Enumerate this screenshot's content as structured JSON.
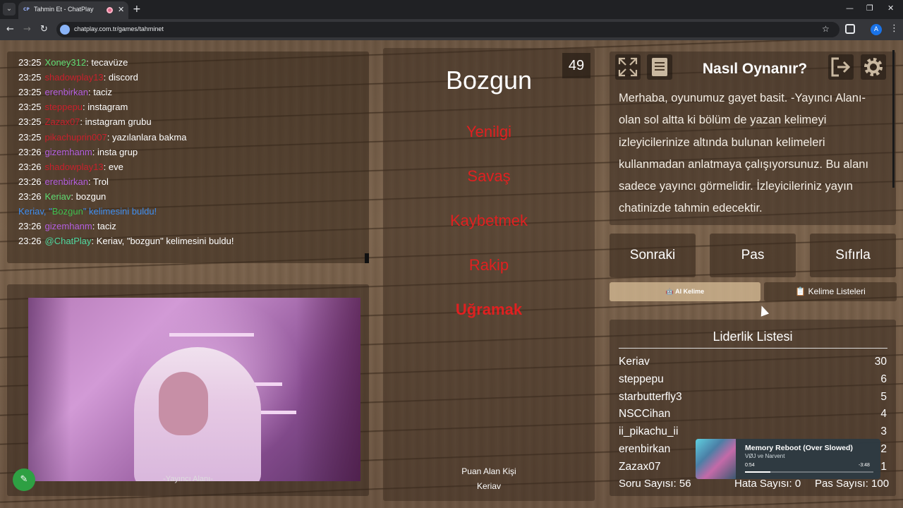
{
  "browser": {
    "tab_title": "Tahmin Et - ChatPlay",
    "tab_favicon": "CP",
    "url": "chatplay.com.tr/games/tahminet",
    "profile_initial": "A"
  },
  "chat": {
    "lines": [
      {
        "time": "23:25",
        "user": "Xoney312",
        "color": "#5fdc73",
        "msg": ": tecavüze"
      },
      {
        "time": "23:25",
        "user": "shadowplay13",
        "color": "#c7202c",
        "msg": ": discord"
      },
      {
        "time": "23:25",
        "user": "erenbirkan",
        "color": "#b35ee0",
        "msg": ": taciz"
      },
      {
        "time": "23:25",
        "user": "steppepu",
        "color": "#c7202c",
        "msg": ": instagram"
      },
      {
        "time": "23:25",
        "user": "Zazax07",
        "color": "#c7202c",
        "msg": ": instagram grubu"
      },
      {
        "time": "23:25",
        "user": "pikachuprin007",
        "color": "#c7202c",
        "msg": ": yazılanlara bakma"
      },
      {
        "time": "23:26",
        "user": "gizemhanm",
        "color": "#b35ee0",
        "msg": ": insta grup"
      },
      {
        "time": "23:26",
        "user": "shadowplay13",
        "color": "#c7202c",
        "msg": ": eve"
      },
      {
        "time": "23:26",
        "user": "erenbirkan",
        "color": "#b35ee0",
        "msg": ": Trol"
      },
      {
        "time": "23:26",
        "user": "Keriav",
        "color": "#5fdc73",
        "msg": ": bozgun"
      },
      {
        "time": "",
        "user": "",
        "color": "",
        "msg": "",
        "notice": true,
        "notice_prefix": "Keriav, \"",
        "notice_word": "Bozgun",
        "notice_suffix": "\" kelimesini buldu!"
      },
      {
        "time": "23:26",
        "user": "gizemhanm",
        "color": "#b35ee0",
        "msg": ": taciz"
      },
      {
        "time": "23:26",
        "user": "@ChatPlay",
        "color": "#4fd8a0",
        "msg": ": Keriav, \"bozgun\" kelimesini buldu!"
      }
    ]
  },
  "stream": {
    "label": "-Yayıncı Alanı-",
    "tool_icon": "✎"
  },
  "card": {
    "counter": "49",
    "word": "Bozgun",
    "taboo": [
      "Yenilgi",
      "Savaş",
      "Kaybetmek",
      "Rakip",
      "Uğramak"
    ],
    "scorer_label": "Puan Alan Kişi",
    "scorer_name": "Keriav"
  },
  "how": {
    "title": "Nasıl Oynanır?",
    "text": "Merhaba, oyunumuz gayet basit. -Yayıncı Alanı- olan sol altta ki bölüm de yazan kelimeyi izleyicilerinize altında bulunan kelimeleri kullanmadan anlatmaya çalışıyorsunuz. Bu alanı sadece yayıncı görmelidir. İzleyicileriniz yayın chatinizde tahmin edecektir."
  },
  "actions": {
    "next": "Sonraki",
    "pass": "Pas",
    "reset": "Sıfırla",
    "ai": "🤖 AI Kelime",
    "lists": "📋 Kelime Listeleri"
  },
  "leaderboard": {
    "title": "Liderlik Listesi",
    "rows": [
      {
        "name": "Keriav",
        "score": "30"
      },
      {
        "name": "steppepu",
        "score": "6"
      },
      {
        "name": "starbutterfly3",
        "score": "5"
      },
      {
        "name": "NSCCihan",
        "score": "4"
      },
      {
        "name": "ii_pikachu_ii",
        "score": "3"
      },
      {
        "name": "erenbirkan",
        "score": "2"
      },
      {
        "name": "Zazax07",
        "score": "1"
      }
    ],
    "question_count": "Soru Sayısı: 56",
    "error_count": "Hata Sayısı: 0",
    "pass_count": "Pas Sayısı: 100"
  },
  "music": {
    "title": "Memory Reboot (Over Slowed)",
    "artist": "VØJ ve Narvent",
    "current": "0:54",
    "remaining": "-3:48",
    "progress": 0.2
  }
}
